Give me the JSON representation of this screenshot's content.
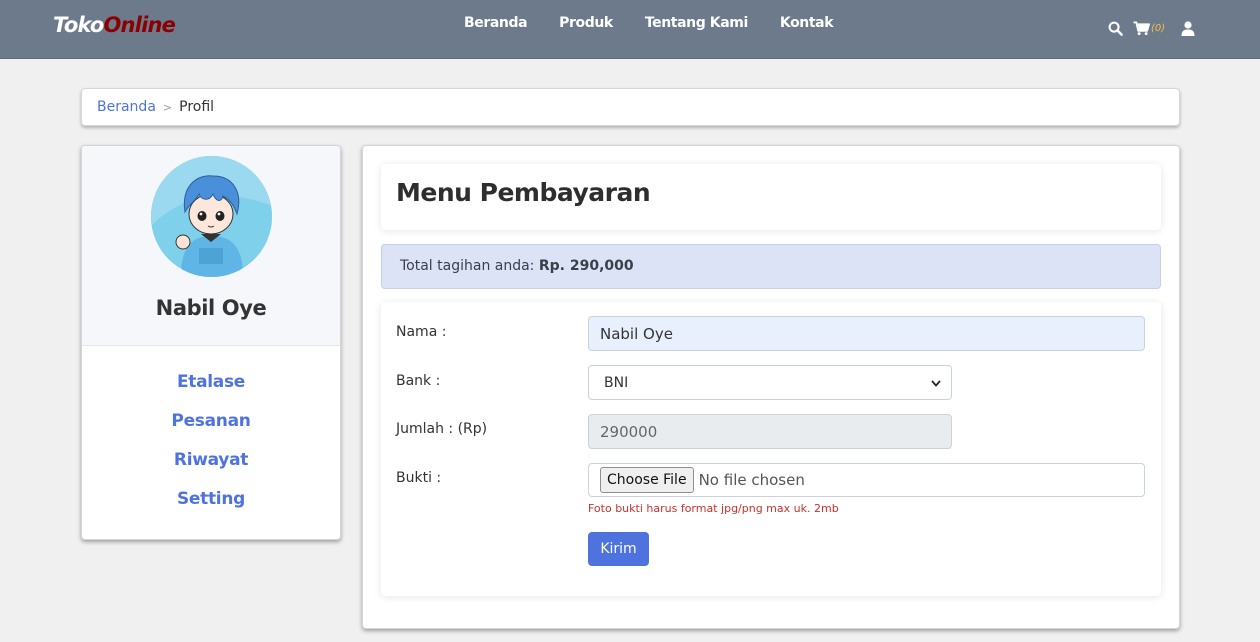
{
  "brand": {
    "part1": "Toko",
    "part2": "Online"
  },
  "nav": {
    "items": [
      "Beranda",
      "Produk",
      "Tentang Kami",
      "Kontak"
    ]
  },
  "header_icons": {
    "search": "search-icon",
    "cart": "cart-icon",
    "cart_count": "(0)",
    "user": "user-icon"
  },
  "breadcrumb": {
    "home": "Beranda",
    "current": "Profil"
  },
  "profile": {
    "name": "Nabil Oye",
    "menu": [
      "Etalase",
      "Pesanan",
      "Riwayat",
      "Setting"
    ]
  },
  "main": {
    "title": "Menu Pembayaran",
    "alert_text": "Total tagihan anda: ",
    "alert_amount": "Rp. 290,000"
  },
  "form": {
    "name_label": "Nama :",
    "name_value": "Nabil Oye",
    "bank_label": "Bank :",
    "bank_value": "BNI",
    "amount_label": "Jumlah : (Rp)",
    "amount_value": "290000",
    "proof_label": "Bukti :",
    "file_button": "Choose File",
    "file_status": "No file chosen",
    "file_help": "Foto bukti harus format jpg/png max uk. 2mb",
    "submit_label": "Kirim"
  },
  "colors": {
    "navbar": "#6c7a8c",
    "accent": "#4e73df",
    "brand_red": "#8b0000",
    "danger": "#c9302c"
  }
}
